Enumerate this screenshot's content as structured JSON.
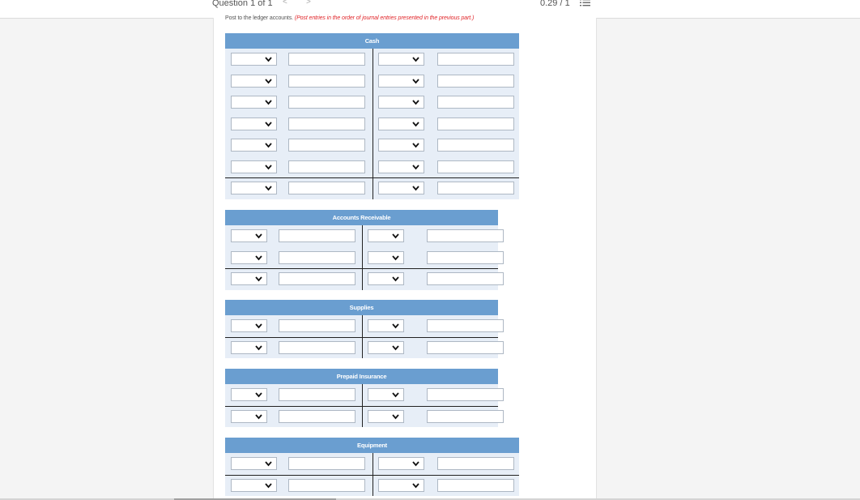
{
  "header": {
    "question_label": "Question 1 of 1",
    "prev_glyph": "<",
    "next_glyph": ">",
    "score": "0.29 / 1"
  },
  "instruction": {
    "lead": "Post to the ledger accounts.",
    "note": "(Post entries in the order of journal entries presented in the previous part.)"
  },
  "accounts": [
    {
      "title": "Cash",
      "rows": 7
    },
    {
      "title": "Accounts Receivable",
      "rows": 3
    },
    {
      "title": "Supplies",
      "rows": 2
    },
    {
      "title": "Prepaid Insurance",
      "rows": 2
    },
    {
      "title": "Equipment",
      "rows": 2
    }
  ]
}
